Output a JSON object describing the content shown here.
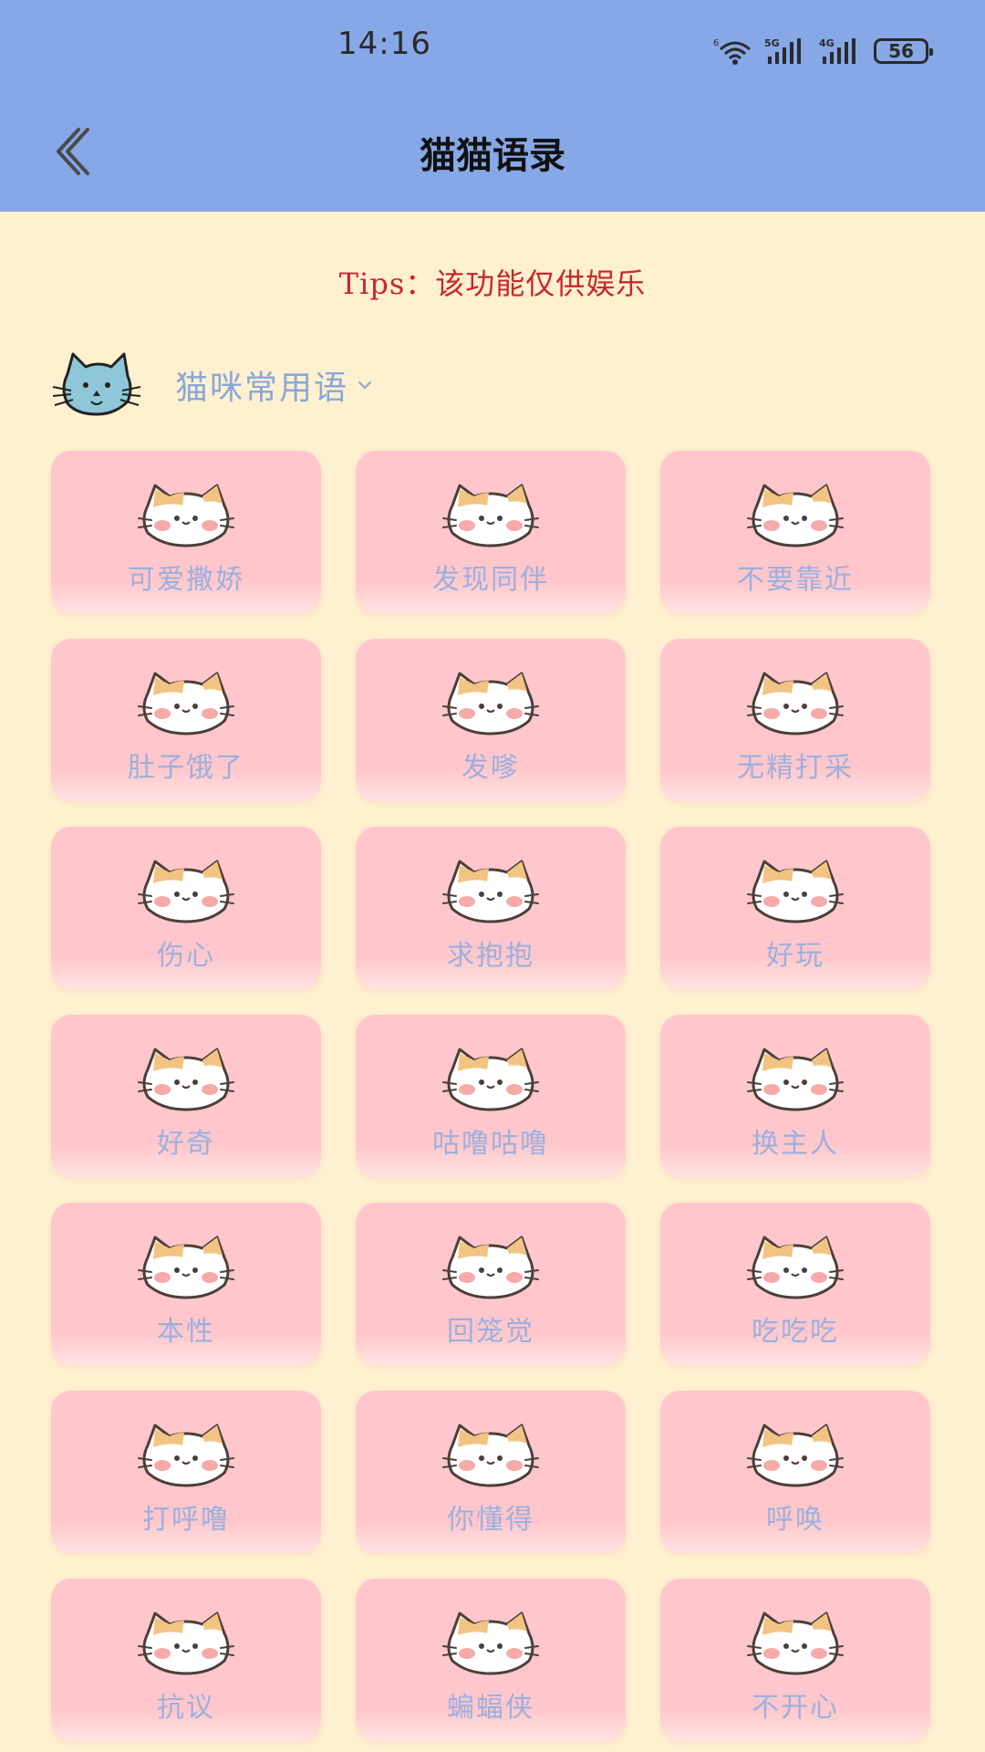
{
  "status_bar": {
    "time": "14:16",
    "battery": "56"
  },
  "header": {
    "title": "猫猫语录",
    "back_icon": "chevron-left-icon"
  },
  "tips": "Tips：该功能仅供娱乐",
  "category": {
    "label": "猫咪常用语",
    "avatar_icon": "cat-face-icon"
  },
  "phrases": [
    "可爱撒娇",
    "发现同伴",
    "不要靠近",
    "肚子饿了",
    "发嗲",
    "无精打采",
    "伤心",
    "求抱抱",
    "好玩",
    "好奇",
    "咕噜咕噜",
    "换主人",
    "本性",
    "回笼觉",
    "吃吃吃",
    "打呼噜",
    "你懂得",
    "呼唤",
    "抗议",
    "蝙蝠侠",
    "不开心"
  ],
  "colors": {
    "header_bg": "#86A8E7",
    "page_bg": "#FFF0D0",
    "card_bg": "#FFC7CB",
    "label_color": "#9BB0DF",
    "tips_color": "#C8282A"
  }
}
